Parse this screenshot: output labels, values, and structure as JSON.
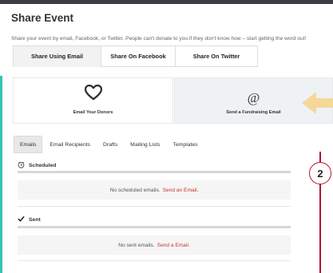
{
  "page": {
    "title": "Share Event",
    "subtitle": "Share your event by email, Facebook, or Twitter. People can't donate to you if they don't know how – start getting the word out!"
  },
  "tabs": [
    {
      "label": "Share Using Email",
      "active": true
    },
    {
      "label": "Share On Facebook",
      "active": false
    },
    {
      "label": "Share On Twitter",
      "active": false
    }
  ],
  "cards": {
    "left": {
      "label": "Email Your Donors",
      "icon": "heart-outline-icon"
    },
    "right": {
      "label": "Send a Fundraising Email",
      "icon": "at-icon",
      "glyph": "@"
    }
  },
  "subnav": [
    {
      "label": "Emails",
      "active": true
    },
    {
      "label": "Email Recipients",
      "active": false
    },
    {
      "label": "Drafts",
      "active": false
    },
    {
      "label": "Mailing Lists",
      "active": false
    },
    {
      "label": "Templates",
      "active": false
    }
  ],
  "scheduled": {
    "heading": "Scheduled",
    "icon": "clock-icon",
    "empty_text": "No scheduled emails.",
    "link": "Send an Email."
  },
  "sent": {
    "heading": "Sent",
    "icon": "check-icon",
    "empty_text": "No sent emails.",
    "link": "Send a Email."
  },
  "annotation": {
    "step_number": "2",
    "arrow_icon": "arrow-left-icon"
  },
  "colors": {
    "accent_teal": "#35c4b4",
    "link_red": "#c0392b",
    "annotation_red": "#b3132a",
    "arrow_yellow": "#f6d79a",
    "header_dark": "#3a3d42"
  }
}
